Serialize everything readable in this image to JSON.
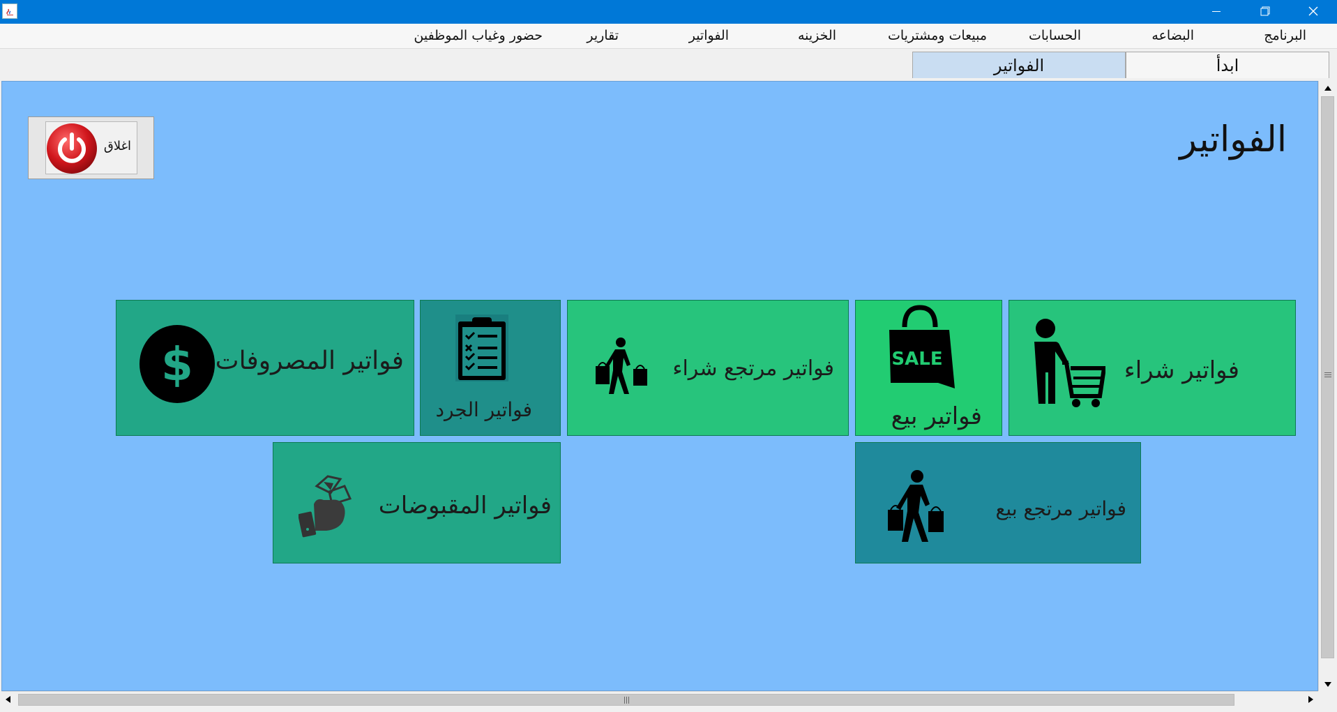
{
  "window": {
    "minimize_label": "minimize",
    "restore_label": "restore",
    "close_label": "close"
  },
  "menu": {
    "items": [
      {
        "label": "البرنامج"
      },
      {
        "label": "البضاعه"
      },
      {
        "label": "الحسابات"
      },
      {
        "label": "مبيعات ومشتريات"
      },
      {
        "label": "الخزينه"
      },
      {
        "label": "الفواتير"
      },
      {
        "label": "تقارير"
      },
      {
        "label": "حضور وغياب الموظفين"
      }
    ]
  },
  "tabs": [
    {
      "label": "ابدأ",
      "active": false
    },
    {
      "label": "الفواتير",
      "active": true
    }
  ],
  "page": {
    "title": "الفواتير",
    "close_button_label": "اغلاق"
  },
  "tiles": {
    "purchase": {
      "label": "فواتير شراء",
      "icon": "shopping-cart-person-icon"
    },
    "sale": {
      "label": "فواتير بيع",
      "icon": "sale-bag-icon",
      "badge": "SALE"
    },
    "purchase_return": {
      "label": "فواتير مرتجع شراء",
      "icon": "shopper-walking-icon"
    },
    "inventory": {
      "label": "فواتير الجرد",
      "icon": "clipboard-checklist-icon"
    },
    "expenses": {
      "label": "فواتير المصروفات",
      "icon": "dollar-coin-icon"
    },
    "sale_return": {
      "label": "فواتير مرتجع بيع",
      "icon": "shopper-walking-icon"
    },
    "receipts": {
      "label": "فواتير المقبوضات",
      "icon": "hand-money-icon"
    }
  },
  "colors": {
    "titlebar": "#0078d7",
    "content_bg": "#7cbcfc",
    "tile_light": "#27c47c",
    "tile_mid": "#22a787",
    "tile_dark": "#1f8a9c",
    "close_red": "#d0161c"
  }
}
